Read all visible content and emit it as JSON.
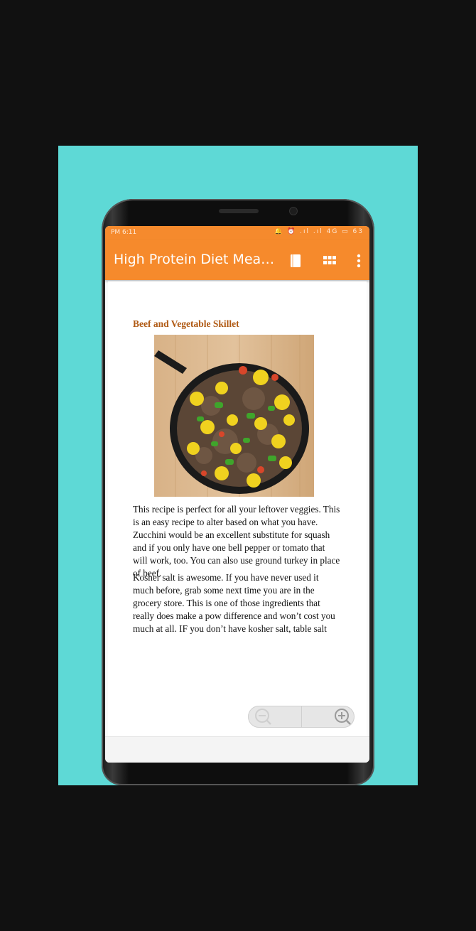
{
  "status_bar": {
    "time": "PM 6:11",
    "icons": "🔔 ⏰ .ıl .ıl 4G ▭ 63"
  },
  "app_bar": {
    "title": "High Protein Diet Mea…",
    "icons": [
      "book-icon",
      "grid-icon",
      "more-vert-icon"
    ]
  },
  "document": {
    "title": "Beef and Vegetable Skillet",
    "paragraphs": [
      "This recipe is perfect for all your leftover veggies. This is an easy recipe to alter based on what you have. Zucchini would be an excellent substitute for squash and if you only have one bell pepper or tomato that will work, too. You can also use ground turkey in place of beef.",
      "Kosher salt is awesome. If you have never used it much before, grab some next time you are in the grocery store. This is one of those ingredients that really does make a pow difference and won’t cost you much at all. IF you don’t have kosher salt, table salt will work as well. I don’t"
    ]
  },
  "zoom": {
    "icons": [
      "zoom-out-icon",
      "zoom-in-icon"
    ]
  },
  "colors": {
    "accent": "#f68a2c",
    "title_text": "#b05a14",
    "promo_background": "#5ed9d6"
  }
}
